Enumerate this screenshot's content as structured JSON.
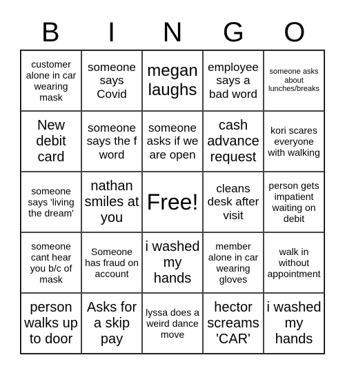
{
  "header": {
    "letters": [
      "B",
      "I",
      "N",
      "G",
      "O"
    ]
  },
  "cells": [
    [
      "customer alone in car wearing mask",
      "someone says Covid",
      "megan laughs",
      "employee says a bad word",
      "someone asks about lunches/breaks"
    ],
    [
      "New debit card",
      "someone says the f word",
      "someone asks if we are open",
      "cash advance request",
      "kori scares everyone with walking"
    ],
    [
      "someone says 'living the dream'",
      "nathan smiles at you",
      "Free!",
      "cleans desk after visit",
      "person gets impatient waiting on debit"
    ],
    [
      "someone cant hear you b/c of mask",
      "Someone has fraud on account",
      "i washed my hands",
      "member alone in car wearing gloves",
      "walk in without appointment"
    ],
    [
      "person walks up to door",
      "Asks for a skip pay",
      "lyssa does a weird dance move",
      "hector screams 'CAR'",
      "i washed my hands"
    ]
  ]
}
